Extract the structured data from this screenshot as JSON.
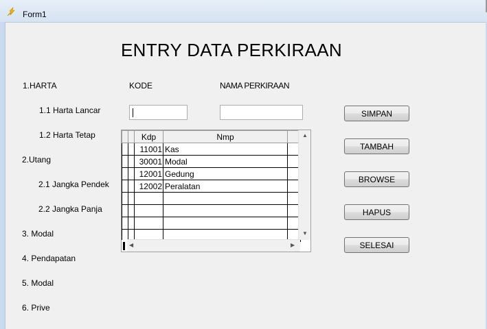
{
  "window": {
    "title": "Form1"
  },
  "heading": "ENTRY DATA PERKIRAAN",
  "menu": [
    "1.HARTA",
    "1.1 Harta Lancar",
    "1.2 Harta Tetap",
    "2.Utang",
    "2.1 Jangka Pendek",
    "2.2 Jangka Panja",
    "3. Modal",
    "4. Pendapatan",
    "5. Modal",
    "6. Prive"
  ],
  "form": {
    "kode_label": "KODE",
    "nama_label": "NAMA PERKIRAAN",
    "kode_value": "",
    "nama_value": ""
  },
  "grid": {
    "headers": [
      "Kdp",
      "Nmp"
    ],
    "rows": [
      [
        "11001",
        "Kas"
      ],
      [
        "30001",
        "Modal"
      ],
      [
        "12001",
        "Gedung"
      ],
      [
        "12002",
        "Peralatan"
      ]
    ]
  },
  "buttons": {
    "simpan": "SIMPAN",
    "tambah": "TAMBAH",
    "browse": "BROWSE",
    "hapus": "HAPUS",
    "selesai": "SELESAI"
  }
}
